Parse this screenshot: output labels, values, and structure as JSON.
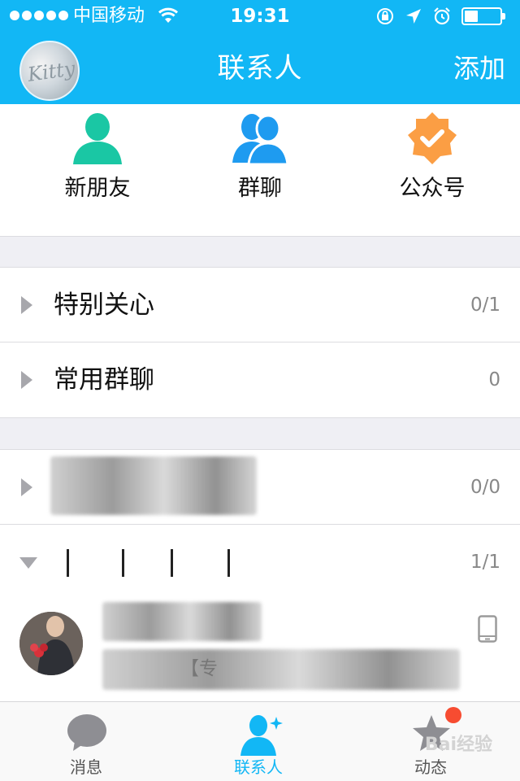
{
  "status_bar": {
    "carrier": "中国移动",
    "time": "19:31"
  },
  "nav": {
    "title": "联系人",
    "add_label": "添加",
    "avatar_text": "Kitty"
  },
  "quick_entries": [
    {
      "label": "新朋友",
      "icon": "person-icon",
      "color": "#1ac7a4"
    },
    {
      "label": "群聊",
      "icon": "group-icon",
      "color": "#1e9bf0"
    },
    {
      "label": "公众号",
      "icon": "verified-badge-icon",
      "color": "#fb9e44"
    }
  ],
  "groups": [
    {
      "name": "特别关心",
      "count": "0/1",
      "expanded": false
    },
    {
      "name": "常用群聊",
      "count": "0",
      "expanded": false
    },
    {
      "name": "",
      "count": "0/0",
      "expanded": false
    },
    {
      "name": "",
      "count": "1/1",
      "expanded": true
    }
  ],
  "contact": {
    "status_fragment": "【专"
  },
  "tabbar": {
    "tabs": [
      {
        "label": "消息",
        "icon": "message-bubble-icon",
        "active": false
      },
      {
        "label": "联系人",
        "icon": "contacts-icon",
        "active": true
      },
      {
        "label": "动态",
        "icon": "star-icon",
        "active": false
      }
    ],
    "watermark": "Bai经验"
  },
  "colors": {
    "brand": "#12b7f5",
    "badge": "#f74c31"
  }
}
